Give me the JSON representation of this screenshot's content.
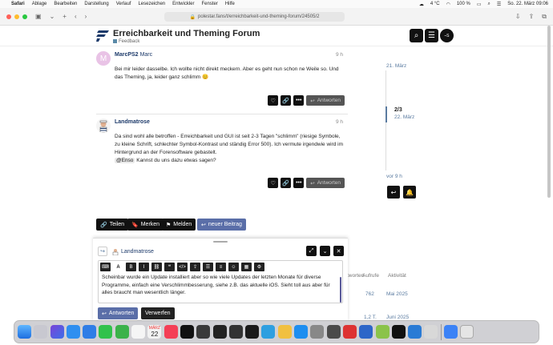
{
  "menubar": {
    "app": "Safari",
    "items": [
      "Ablage",
      "Bearbeiten",
      "Darstellung",
      "Verlauf",
      "Lesezeichen",
      "Entwickler",
      "Fenster",
      "Hilfe"
    ],
    "temperature": "4 °C",
    "battery": "100 %",
    "datetime": "So. 22. März 09:06"
  },
  "browser": {
    "url": "polestar.fans/t/erreichbarkeit-und-theming-forum/24505/2"
  },
  "forum": {
    "title": "Erreichbarkeit und Theming Forum",
    "category": "Feedback",
    "avatar_text": "⎯S"
  },
  "posts": [
    {
      "author": "MarcPS2",
      "username": "Marc",
      "avatar_letter": "M",
      "time": "9 h",
      "text": "Bei mir leider dasselbe. Ich wollte nicht direkt meckern. Aber es geht nun schon ne Weile so. Und das Theming, ja, leider ganz schlimm 😊",
      "reply_label": "Antworten"
    },
    {
      "author": "Landmatrose",
      "time": "9 h",
      "text": "Da sind wohl alle betroffen - Erreichbarkeit und GUI ist seit 2-3 Tagen \"schlimm\" (riesige Symbole, zu kleine Schrift, schlechter Symbol-Kontrast und ständig Error 500). Ich vermute irgendwie wird im Hintergrund an der Forensoftware gebastelt.",
      "mention": "@Enso",
      "text2": "Kannst du uns dazu etwas sagen?",
      "reply_label": "Antworten"
    }
  ],
  "timeline": {
    "start_date": "21. März",
    "position": "2/3",
    "current_date": "22. März",
    "end_label": "vor 9 h"
  },
  "topic_actions": {
    "share": "Teilen",
    "bookmark": "Merken",
    "flag": "Melden",
    "new_post": "neuer Beitrag"
  },
  "table": {
    "headers": [
      "Antworten",
      "Aufrufe",
      "Aktivität"
    ],
    "rows": [
      {
        "views": "762",
        "activity": "Mai 2025"
      },
      {
        "views": "1,2 T.",
        "activity": "Juni 2025"
      }
    ]
  },
  "composer": {
    "reply_to": "Landmatrose",
    "text": "Scheinbar wurde ein Update installiert aber so wie viele Updates der letzten Monate für diverse Programme, einfach eine Verschlimmbesserung, siehe z.B. das aktuelle iOS. Sieht toll aus aber für alles braucht man wesentlich länger.",
    "submit": "Antworten",
    "cancel": "Verwerfen"
  },
  "dock_calendar": {
    "month": "MÄRZ",
    "day": "22"
  },
  "colors": {
    "accent": "#5a6ea8",
    "link": "#1d3a6a",
    "date": "#5a7ba0"
  }
}
